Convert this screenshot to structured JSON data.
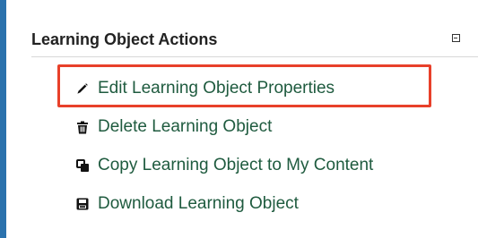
{
  "panel": {
    "title": "Learning Object Actions",
    "collapse_icon": "collapse-box-icon"
  },
  "actions": [
    {
      "label": "Edit Learning Object Properties",
      "icon": "pencil-icon"
    },
    {
      "label": "Delete Learning Object",
      "icon": "trash-icon"
    },
    {
      "label": "Copy Learning Object to My Content",
      "icon": "copy-icon"
    },
    {
      "label": "Download Learning Object",
      "icon": "download-icon"
    }
  ],
  "colors": {
    "accent_border": "#2b72ad",
    "link_text": "#1f5b3f",
    "highlight": "#e8402a"
  }
}
